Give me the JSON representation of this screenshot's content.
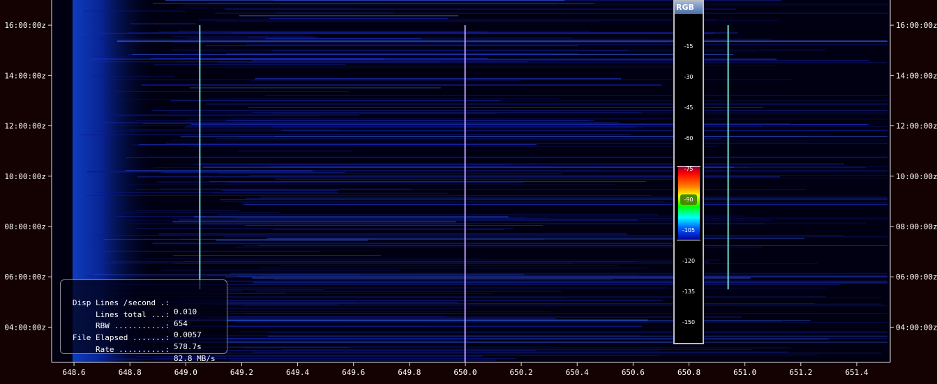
{
  "chart_data": {
    "type": "heatmap",
    "title": "",
    "xlabel": "",
    "ylabel": "",
    "x_ticks": [
      648.6,
      648.8,
      649.0,
      649.2,
      649.4,
      649.6,
      649.8,
      650.0,
      650.2,
      650.4,
      650.6,
      650.8,
      651.0,
      651.2,
      651.4
    ],
    "x_tick_labels": [
      "648.6",
      "648.8",
      "649.0",
      "649.2",
      "649.4",
      "649.6",
      "649.8",
      "650.0",
      "650.2",
      "650.4",
      "650.6",
      "650.8",
      "651.0",
      "651.2",
      "651.4"
    ],
    "xlim": [
      648.52,
      651.52
    ],
    "y_tick_labels": [
      "16:00:00z",
      "14:00:00z",
      "12:00:00z",
      "10:00:00z",
      "08:00:00z",
      "06:00:00z",
      "04:00:00z"
    ],
    "y_tick_hours": [
      16,
      14,
      12,
      10,
      8,
      6,
      4
    ],
    "ylim_hours": [
      2.6,
      17.0
    ],
    "vertical_signals": [
      {
        "freq": 649.05,
        "start_hour": 5.5,
        "end_hour": 16.0,
        "color": "#6fe0d0"
      },
      {
        "freq": 649.999,
        "start_hour": 2.6,
        "end_hour": 16.0,
        "color": "#c0a0ff"
      },
      {
        "freq": 650.94,
        "start_hour": 5.5,
        "end_hour": 16.0,
        "color": "#6fe0d0"
      }
    ],
    "colorbar": {
      "title": "RGB",
      "ticks": [
        -15,
        -30,
        -45,
        -60,
        -75,
        -90,
        -105,
        -120,
        -135,
        -150
      ],
      "tick_labels": [
        "-15",
        "-30",
        "-45",
        "-60",
        "-75",
        "-90",
        "-105",
        "-120",
        "-135",
        "-150"
      ],
      "range_active": [
        -75,
        -105
      ],
      "marker": -90
    }
  },
  "info": {
    "rows": [
      {
        "label": "Disp Lines /second .:",
        "value": "0.010"
      },
      {
        "label": "Lines total ...:",
        "value": "654"
      },
      {
        "label": "RBW ...........:",
        "value": "0.0057"
      },
      {
        "label": "File Elapsed .......:",
        "value": "578.7s"
      },
      {
        "label": "Rate ..........:",
        "value": "82.8 MB/s"
      }
    ]
  },
  "colors": {
    "background": "#140202",
    "plot_bg": "#000010",
    "noise_blue": "#0a1aa0",
    "axis": "#e0e0e0"
  }
}
